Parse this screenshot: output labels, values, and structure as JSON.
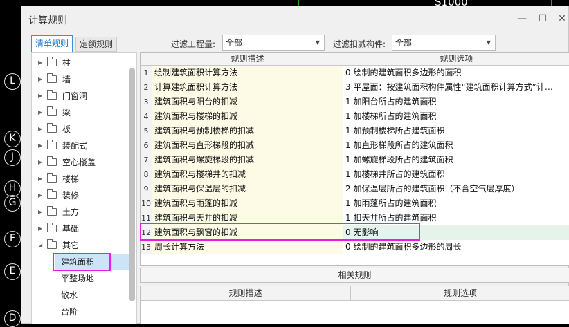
{
  "cad": {
    "top_label": "S1000",
    "axis_markers": [
      "L",
      "K",
      "J",
      "H",
      "G",
      "F",
      "E",
      "D"
    ]
  },
  "dialog": {
    "title": "计算规则",
    "minimize": "—",
    "maximize": "☐",
    "close": "✕"
  },
  "tabs": {
    "active": "清单规则",
    "inactive": "定额规则"
  },
  "filters": {
    "quantity_label": "过滤工程量:",
    "quantity_value": "全部",
    "deduct_label": "过滤扣减构件:",
    "deduct_value": "全部"
  },
  "tree": {
    "items": [
      "柱",
      "墙",
      "门窗洞",
      "梁",
      "板",
      "装配式",
      "空心楼盖",
      "楼梯",
      "装修",
      "土方",
      "基础",
      "其它"
    ],
    "children": [
      "建筑面积",
      "平整场地",
      "散水",
      "台阶"
    ]
  },
  "grid": {
    "col_desc": "规则描述",
    "col_option": "规则选项",
    "rows": [
      {
        "n": "1",
        "desc": "绘制建筑面积计算方法",
        "option": "0 绘制的建筑面积多边形的面积"
      },
      {
        "n": "2",
        "desc": "计算建筑面积计算方法",
        "option": "3 平屋面：按建筑面积构件属性“建筑面积计算方式”计…"
      },
      {
        "n": "3",
        "desc": "建筑面积与阳台的扣减",
        "option": "1 加阳台所占的建筑面积"
      },
      {
        "n": "4",
        "desc": "建筑面积与楼梯的扣减",
        "option": "1 加楼梯所占的建筑面积"
      },
      {
        "n": "5",
        "desc": "建筑面积与预制楼梯的扣减",
        "option": "1 加预制楼梯所占建筑面积"
      },
      {
        "n": "6",
        "desc": "建筑面积与直形梯段的扣减",
        "option": "1 加直形梯段所占的建筑面积"
      },
      {
        "n": "7",
        "desc": "建筑面积与螺旋梯段的扣减",
        "option": "1 加螺旋梯段所占的建筑面积"
      },
      {
        "n": "8",
        "desc": "建筑面积与楼梯井的扣减",
        "option": "1 加楼梯井所占的建筑面积"
      },
      {
        "n": "9",
        "desc": "建筑面积与保温层的扣减",
        "option": "2 加保温层所占的建筑面积（不含空气层厚度）"
      },
      {
        "n": "10",
        "desc": "建筑面积与雨蓬的扣减",
        "option": "1 加雨蓬所占的建筑面积"
      },
      {
        "n": "11",
        "desc": "建筑面积与天井的扣减",
        "option": "1 扣天井所占的建筑面积"
      },
      {
        "n": "12",
        "desc": "建筑面积与飘窗的扣减",
        "option": "0  无影响"
      },
      {
        "n": "13",
        "desc": "周长计算方法",
        "option": "0 绘制的建筑面积多边形的周长"
      }
    ]
  },
  "related": {
    "title": "相关规则",
    "col_desc": "规则描述",
    "col_option": "规则选项"
  },
  "colors": {
    "accent": "#1a73c8",
    "highlight": "#e61de6",
    "desc_bg": "#fdfbe6",
    "selected_row_bg": "#e6f3ea"
  }
}
